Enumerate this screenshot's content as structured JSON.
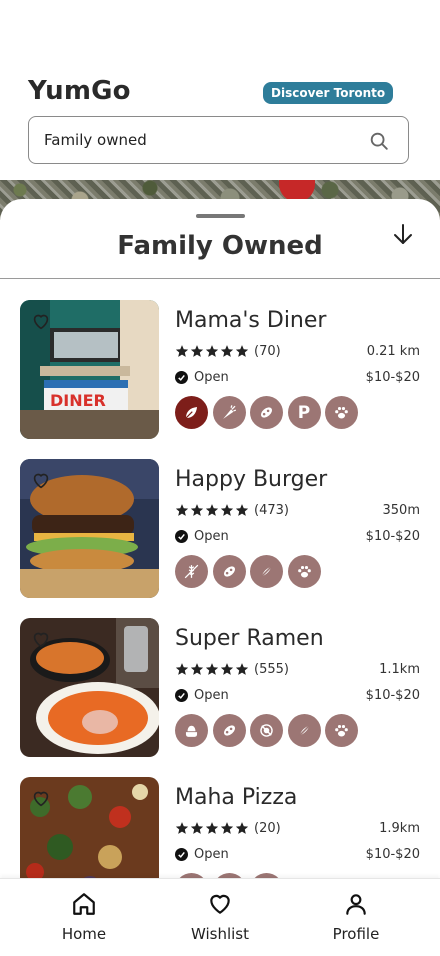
{
  "header": {
    "app_title": "YumGo",
    "city_badge": "Discover Toronto",
    "search": {
      "value": "Family owned"
    }
  },
  "sheet": {
    "title": "Family Owned"
  },
  "restaurants": [
    {
      "name": "Mama's Diner",
      "rating": 5,
      "reviews": "(70)",
      "distance": "0.21 km",
      "status": "Open",
      "price": "$10-$20",
      "tags": [
        "leaf-icon",
        "carrot-icon",
        "soy-icon",
        "parking-icon",
        "paw-icon"
      ]
    },
    {
      "name": "Happy Burger",
      "rating": 5,
      "reviews": "(473)",
      "distance": "350m",
      "status": "Open",
      "price": "$10-$20",
      "tags": [
        "gluten-free-icon",
        "soy-icon",
        "no-dairy-icon",
        "paw-icon"
      ]
    },
    {
      "name": "Super Ramen",
      "rating": 5,
      "reviews": "(555)",
      "distance": "1.1km",
      "status": "Open",
      "price": "$10-$20",
      "tags": [
        "halal-icon",
        "soy-icon",
        "no-nuts-icon",
        "no-dairy-icon",
        "paw-icon"
      ]
    },
    {
      "name": "Maha Pizza",
      "rating": 5,
      "reviews": "(20)",
      "distance": "1.9km",
      "status": "Open",
      "price": "$10-$20",
      "tags": [
        "gluten-free-icon",
        "soy-icon",
        "no-dairy-icon"
      ]
    }
  ],
  "nav": {
    "home": "Home",
    "wishlist": "Wishlist",
    "profile": "Profile"
  },
  "colors": {
    "badge": "#2e7d9a",
    "tag": "#9c7674",
    "tag_active": "#7d1e1a",
    "pin": "#c62828"
  }
}
